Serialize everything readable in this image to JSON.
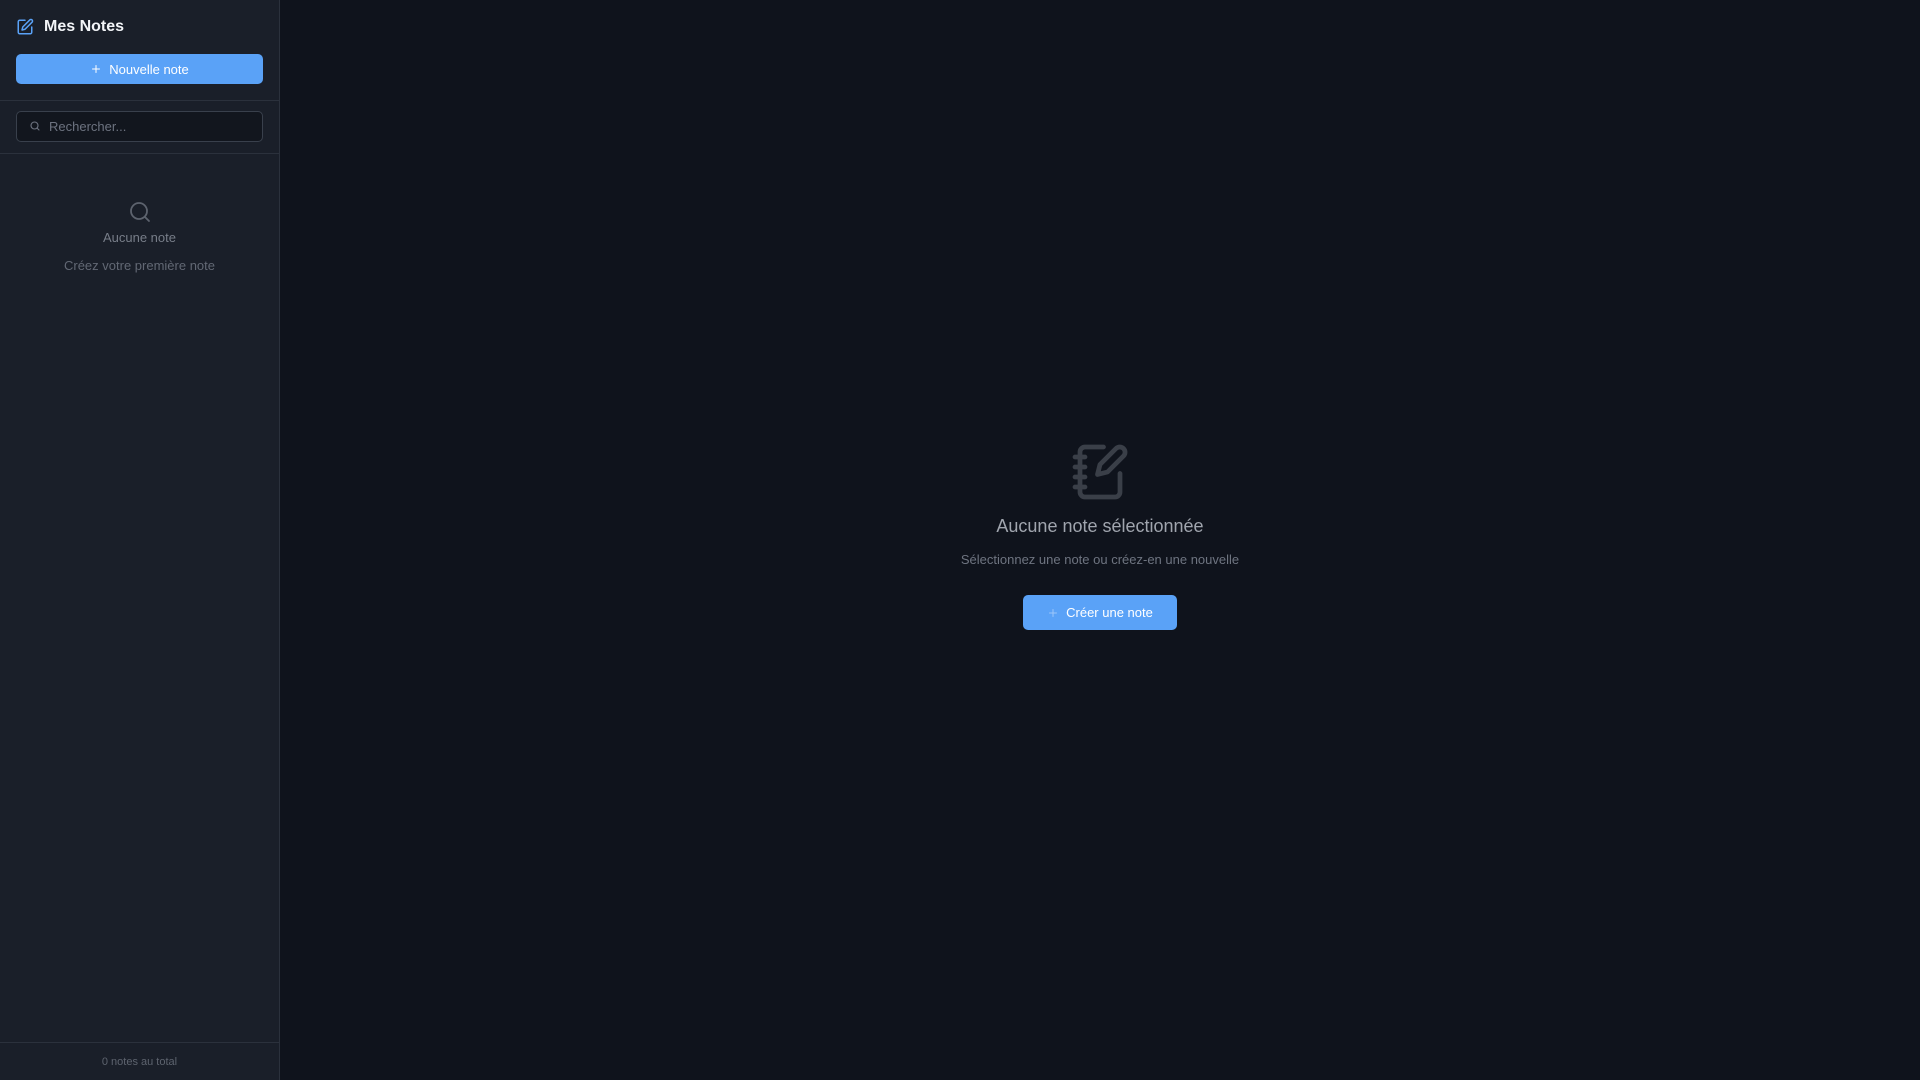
{
  "sidebar": {
    "brand": {
      "title": "Mes Notes",
      "icon": "note-edit-icon"
    },
    "new_note_label": "Nouvelle note",
    "search": {
      "placeholder": "Rechercher...",
      "value": ""
    },
    "empty_state": {
      "icon": "search-icon",
      "title": "Aucune note",
      "subtitle": "Créez votre première note"
    },
    "footer": {
      "count_text": "0 notes au total"
    }
  },
  "main": {
    "empty_state": {
      "icon": "notebook-pen-icon",
      "title": "Aucune note sélectionnée",
      "subtitle": "Sélectionnez une note ou créez-en une nouvelle",
      "create_label": "Créer une note"
    }
  },
  "colors": {
    "accent": "#5aa2f7",
    "sidebar_bg": "#1a1f29",
    "main_bg": "#0f131c"
  }
}
